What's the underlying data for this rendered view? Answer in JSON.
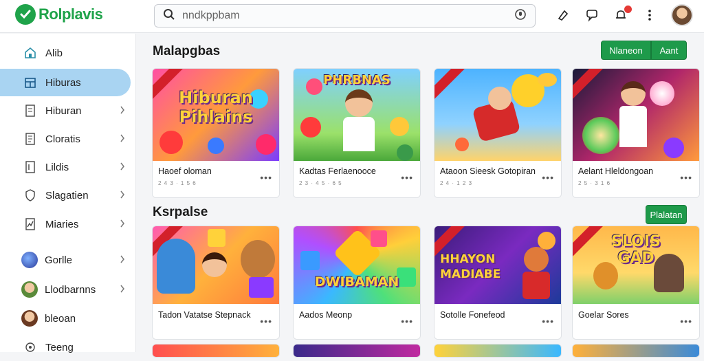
{
  "app": {
    "name": "Rolplavis"
  },
  "search": {
    "placeholder": "nndkppbam"
  },
  "sidebar": {
    "items": [
      {
        "label": "Alib",
        "icon": "home-icon"
      },
      {
        "label": "Hiburas",
        "icon": "store-icon",
        "active": true
      },
      {
        "label": "Hiburan",
        "icon": "tablet-icon",
        "chevron": true
      },
      {
        "label": "Cloratis",
        "icon": "document-icon",
        "chevron": true
      },
      {
        "label": "Lildis",
        "icon": "book-icon",
        "chevron": true
      },
      {
        "label": "Slagatien",
        "icon": "shield-icon",
        "chevron": true
      },
      {
        "label": "Miaries",
        "icon": "chart-icon",
        "chevron": true
      },
      {
        "label": "Gorlle",
        "avatar": "globe-avatar",
        "chevron": true
      },
      {
        "label": "Llodbarnns",
        "avatar": "user-avatar",
        "chevron": true
      },
      {
        "label": "bleoan",
        "avatar": "user-avatar"
      },
      {
        "label": "Teeng",
        "icon": "settings-icon"
      }
    ]
  },
  "section1": {
    "title": "Malapgbas",
    "buttons": [
      "Nlaneon",
      "Aant"
    ],
    "cards": [
      {
        "name": "Haoef oloman",
        "meta": "2 4 3 · 1 5 6",
        "thumb_title_1": "Hiburan",
        "thumb_title_2": "Pihlains",
        "bg": "linear-gradient(135deg,#ff4fa3,#ff9a3c 50%,#7a3cff)"
      },
      {
        "name": "Kadtas Ferlaenooce",
        "meta": "2 3 · 4 5 · 6 5",
        "thumb_title_1": "PHRBNAS",
        "thumb_title_2": "",
        "bg": "linear-gradient(180deg,#7fd0ff,#9be16a 70%,#4aa83a)"
      },
      {
        "name": "Ataoon Sieesk Gotopiran",
        "meta": "2 4 · 1 2 3",
        "thumb_title_1": "",
        "thumb_title_2": "",
        "bg": "linear-gradient(180deg,#4db3ff,#8fd2ff 60%,#ffd36a)"
      },
      {
        "name": "Aelant Hleldongoan",
        "meta": "2 5 · 3 1 6",
        "thumb_title_1": "",
        "thumb_title_2": "",
        "bg": "linear-gradient(135deg,#1a1a3a,#b0266a 50%,#ff9a3c)"
      }
    ]
  },
  "section2": {
    "title": "Ksrpalse",
    "buttons": [
      "Plalatan"
    ],
    "cards": [
      {
        "name": "Tadon Vatatse Stepnack",
        "meta": "",
        "thumb_title_1": "",
        "thumb_title_2": "",
        "bg": "linear-gradient(135deg,#ff5bb0,#ffb13c 50%,#ff7a3c)"
      },
      {
        "name": "Aados Meonp",
        "meta": "",
        "thumb_title_1": "DWIBAMAN",
        "thumb_title_2": "",
        "bg": "conic-gradient(from 0deg,#ff4f4f,#ffcf3a,#4fe07a,#3ab8ff,#b04fff,#ff4f4f)"
      },
      {
        "name": "Sotolle Fonefeod",
        "meta": "",
        "thumb_title_1": "HHAYON",
        "thumb_title_2": "MADIABE",
        "bg": "linear-gradient(135deg,#3b1c7a,#7a2ac0 50%,#1c3a9a)"
      },
      {
        "name": "Goelar Sores",
        "meta": "",
        "thumb_title_1": "SLOIS",
        "thumb_title_2": "GAD",
        "bg": "linear-gradient(180deg,#ffb84a,#ffd96a 60%,#7fd06a)"
      }
    ]
  },
  "colors": {
    "brand": "#1fa34a",
    "active_nav": "#a9d4f2",
    "button": "#1e9a4a",
    "ribbon": "#d3202a"
  }
}
